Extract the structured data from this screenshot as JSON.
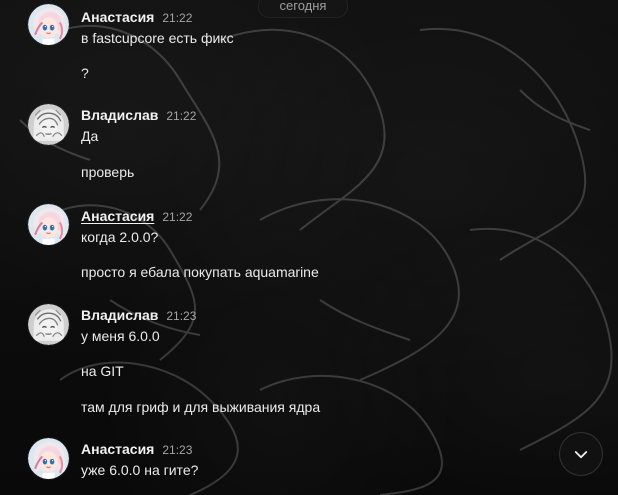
{
  "date_divider": "сегодня",
  "messages": [
    {
      "author": "Анастасия",
      "time": "21:22",
      "lines": [
        "в fastcupcore есть фикс",
        "?"
      ],
      "avatar": "anime-girl-avatar",
      "name_underlined": false
    },
    {
      "author": "Владислав",
      "time": "21:22",
      "lines": [
        "Да",
        "проверь"
      ],
      "avatar": "anime-sketch-avatar",
      "name_underlined": false
    },
    {
      "author": "Анастасия",
      "time": "21:22",
      "lines": [
        "когда 2.0.0?",
        "просто я ебала покупать aquamarine"
      ],
      "avatar": "anime-girl-avatar",
      "name_underlined": true
    },
    {
      "author": "Владислав",
      "time": "21:23",
      "lines": [
        "у меня 6.0.0",
        "на GIT",
        "там для гриф и для выживания ядра"
      ],
      "avatar": "anime-sketch-avatar",
      "name_underlined": false
    },
    {
      "author": "Анастасия",
      "time": "21:23",
      "lines": [
        "уже 6.0.0 на гите?"
      ],
      "avatar": "anime-girl-avatar",
      "name_underlined": false
    }
  ],
  "scroll_button": {
    "icon": "chevron-down-icon"
  },
  "colors": {
    "background": "#0b0b0b",
    "text": "#ebebeb",
    "time": "#a4a4a4"
  }
}
